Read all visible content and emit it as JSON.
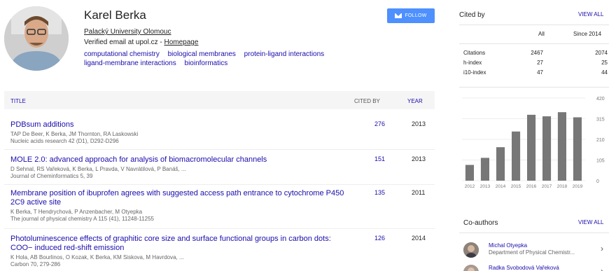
{
  "profile": {
    "name": "Karel Berka",
    "affiliation": "Palacký University Olomouc",
    "email_prefix": "Verified email at upol.cz - ",
    "homepage": "Homepage",
    "interests": [
      "computational chemistry",
      "biological membranes",
      "protein-ligand interactions",
      "ligand-membrane interactions",
      "bioinformatics"
    ],
    "follow_label": "FOLLOW"
  },
  "table": {
    "title_header": "TITLE",
    "cited_header": "CITED BY",
    "year_header": "YEAR",
    "articles": [
      {
        "title": "PDBsum additions",
        "authors": "TAP De Beer, K Berka, JM Thornton, RA Laskowski",
        "venue": "Nucleic acids research 42 (D1), D292-D296",
        "cited": "276",
        "year": "2013"
      },
      {
        "title": "MOLE 2.0: advanced approach for analysis of biomacromolecular channels",
        "authors": "D Sehnal, RS Vařeková, K Berka, L Pravda, V Navrátilová, P Banáš, ...",
        "venue": "Journal of Cheminformatics 5, 39",
        "cited": "151",
        "year": "2013"
      },
      {
        "title": "Membrane position of ibuprofen agrees with suggested access path entrance to cytochrome P450 2C9 active site",
        "authors": "K Berka, T Hendrychová, P Anzenbacher, M Otyepka",
        "venue": "The journal of physical chemistry A 115 (41), 11248-11255",
        "cited": "135",
        "year": "2011"
      },
      {
        "title": "Photoluminescence effects of graphitic core size and surface functional groups in carbon dots: COO− induced red-shift emission",
        "authors": "K Hola, AB Bourlinos, O Kozak, K Berka, KM Siskova, M Havrdova, ...",
        "venue": "Carbon 70, 279-286",
        "cited": "126",
        "year": "2014"
      }
    ]
  },
  "cited_by": {
    "title": "Cited by",
    "view_all": "VIEW ALL",
    "col_all": "All",
    "col_since": "Since 2014",
    "rows": [
      {
        "label": "Citations",
        "all": "2467",
        "since": "2074"
      },
      {
        "label": "h-index",
        "all": "27",
        "since": "25"
      },
      {
        "label": "i10-index",
        "all": "47",
        "since": "44"
      }
    ]
  },
  "chart_data": {
    "type": "bar",
    "categories": [
      "2012",
      "2013",
      "2014",
      "2015",
      "2016",
      "2017",
      "2018",
      "2019"
    ],
    "values": [
      80,
      116,
      170,
      250,
      335,
      327,
      348,
      322
    ],
    "y_ticks": [
      "0",
      "105",
      "210",
      "315",
      "420"
    ],
    "ylim": [
      0,
      420
    ],
    "bar_color": "#777777"
  },
  "coauthors": {
    "title": "Co-authors",
    "view_all": "VIEW ALL",
    "items": [
      {
        "name": "Michal Otyepka",
        "dept": "Department of Physical Chemistr..."
      },
      {
        "name": "Radka Svobodová Vařeková",
        "dept": ""
      }
    ]
  }
}
